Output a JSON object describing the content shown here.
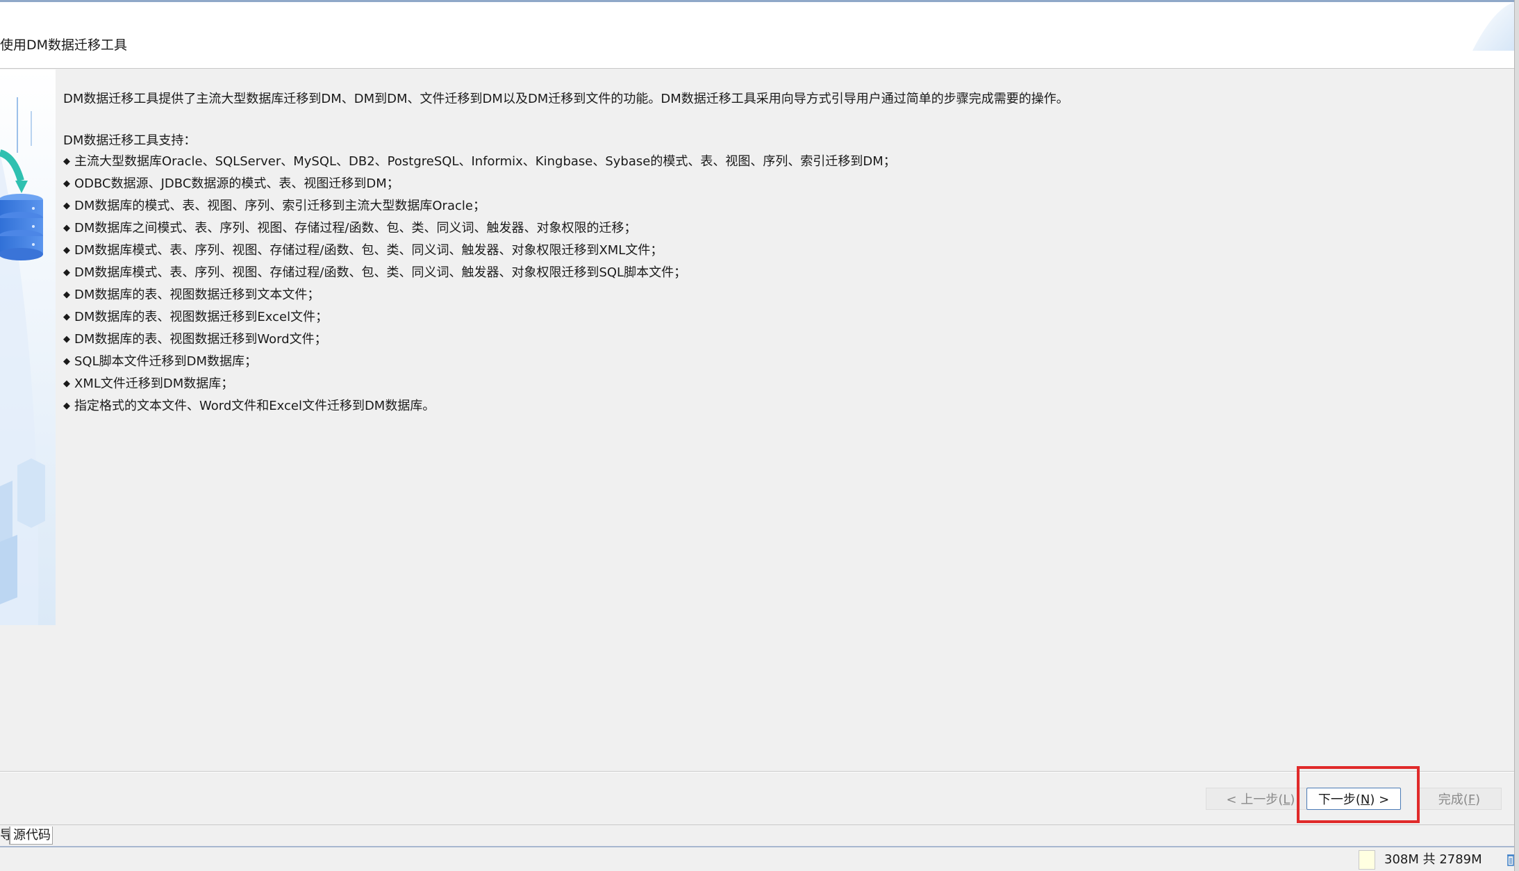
{
  "header": {
    "title": "使用DM数据迁移工具"
  },
  "content": {
    "intro": "DM数据迁移工具提供了主流大型数据库迁移到DM、DM到DM、文件迁移到DM以及DM迁移到文件的功能。DM数据迁移工具采用向导方式引导用户通过简单的步骤完成需要的操作。",
    "support_heading": "DM数据迁移工具支持：",
    "features": [
      "主流大型数据库Oracle、SQLServer、MySQL、DB2、PostgreSQL、Informix、Kingbase、Sybase的模式、表、视图、序列、索引迁移到DM；",
      "ODBC数据源、JDBC数据源的模式、表、视图迁移到DM；",
      "DM数据库的模式、表、视图、序列、索引迁移到主流大型数据库Oracle；",
      "DM数据库之间模式、表、序列、视图、存储过程/函数、包、类、同义词、触发器、对象权限的迁移；",
      "DM数据库模式、表、序列、视图、存储过程/函数、包、类、同义词、触发器、对象权限迁移到XML文件；",
      "DM数据库模式、表、序列、视图、存储过程/函数、包、类、同义词、触发器、对象权限迁移到SQL脚本文件；",
      "DM数据库的表、视图数据迁移到文本文件；",
      "DM数据库的表、视图数据迁移到Excel文件；",
      "DM数据库的表、视图数据迁移到Word文件；",
      "SQL脚本文件迁移到DM数据库；",
      "XML文件迁移到DM数据库；",
      "指定格式的文本文件、Word文件和Excel文件迁移到DM数据库。"
    ]
  },
  "buttons": {
    "prev": {
      "pre": "< 上一步(",
      "key": "L",
      "post": ")"
    },
    "next": {
      "pre": "下一步(",
      "key": "N",
      "post": ") >"
    },
    "finish": {
      "pre": "完成(",
      "key": "F",
      "post": ")"
    }
  },
  "tabs": {
    "partial": "导",
    "source": "源代码"
  },
  "status": {
    "memory": "308M 共 2789M"
  },
  "colors": {
    "highlight": "#e02a2a",
    "accent_blue": "#4a7ab5"
  }
}
